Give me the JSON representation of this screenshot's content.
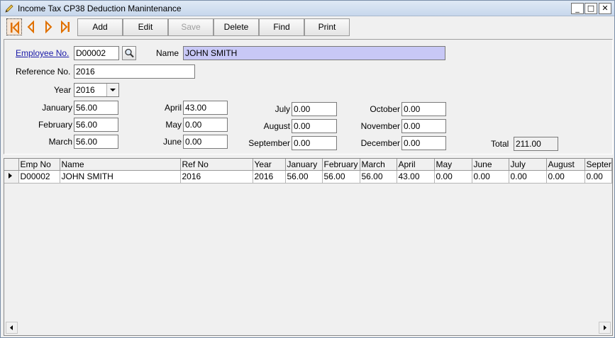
{
  "window": {
    "title": "Income Tax CP38 Deduction Manintenance",
    "controls": {
      "minimize": "_",
      "maximize": "□",
      "close": "✕"
    }
  },
  "toolbar": {
    "add_label": "Add",
    "edit_label": "Edit",
    "save_label": "Save",
    "delete_label": "Delete",
    "find_label": "Find",
    "print_label": "Print"
  },
  "form": {
    "employee_no_label": "Employee No.",
    "employee_no_value": "D00002",
    "name_label": "Name",
    "name_value": "JOHN SMITH",
    "reference_no_label": "Reference No.",
    "reference_no_value": "2016",
    "year_label": "Year",
    "year_value": "2016",
    "months": {
      "january": {
        "label": "January",
        "value": "56.00"
      },
      "february": {
        "label": "February",
        "value": "56.00"
      },
      "march": {
        "label": "March",
        "value": "56.00"
      },
      "april": {
        "label": "April",
        "value": "43.00"
      },
      "may": {
        "label": "May",
        "value": "0.00"
      },
      "june": {
        "label": "June",
        "value": "0.00"
      },
      "july": {
        "label": "July",
        "value": "0.00"
      },
      "august": {
        "label": "August",
        "value": "0.00"
      },
      "september": {
        "label": "September",
        "value": "0.00"
      },
      "october": {
        "label": "October",
        "value": "0.00"
      },
      "november": {
        "label": "November",
        "value": "0.00"
      },
      "december": {
        "label": "December",
        "value": "0.00"
      }
    },
    "total_label": "Total",
    "total_value": "211.00"
  },
  "grid": {
    "columns": [
      "Emp No",
      "Name",
      "Ref No",
      "Year",
      "January",
      "February",
      "March",
      "April",
      "May",
      "June",
      "July",
      "August",
      "Septer"
    ],
    "rows": [
      [
        "D00002",
        "JOHN SMITH",
        "2016",
        "2016",
        "56.00",
        "56.00",
        "56.00",
        "43.00",
        "0.00",
        "0.00",
        "0.00",
        "0.00",
        "0.00"
      ]
    ]
  },
  "colors": {
    "name_field_bg": "#c8c8f6",
    "nav_arrow": "#e07000",
    "link": "#1a1aa8"
  },
  "icons": {
    "app": "pencil-icon",
    "nav_first": "first-record-icon",
    "nav_prev": "previous-record-icon",
    "nav_next": "next-record-icon",
    "nav_last": "last-record-icon",
    "lookup": "search-icon",
    "dropdown": "chevron-down-icon"
  }
}
